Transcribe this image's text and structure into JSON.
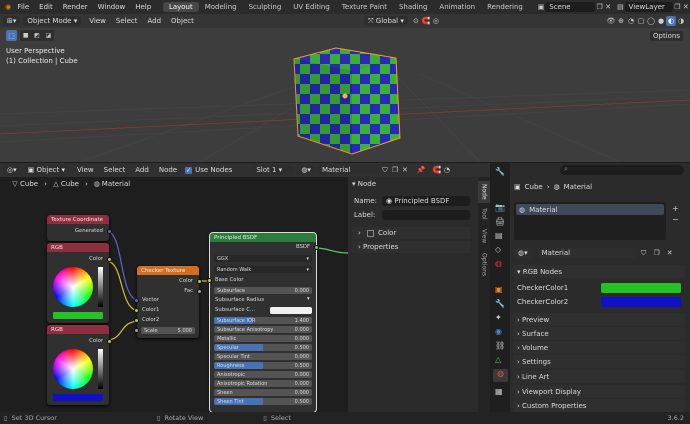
{
  "topbar": {
    "menus": [
      "File",
      "Edit",
      "Render",
      "Window",
      "Help"
    ],
    "workspaces": [
      "Layout",
      "Modeling",
      "Sculpting",
      "UV Editing",
      "Texture Paint",
      "Shading",
      "Animation",
      "Rendering"
    ],
    "active_workspace": "Layout",
    "scene": "Scene",
    "view_layer": "ViewLayer"
  },
  "viewport": {
    "mode": "Object Mode",
    "menus": [
      "View",
      "Select",
      "Add",
      "Object"
    ],
    "transform": "Global",
    "perspective": "User Perspective",
    "collection": "(1) Collection | Cube",
    "options": "Options"
  },
  "node_editor": {
    "editor_type": "Object",
    "menus": [
      "View",
      "Select",
      "Add",
      "Node"
    ],
    "use_nodes": "Use Nodes",
    "slot": "Slot 1",
    "material": "Material",
    "breadcrumb": [
      "Cube",
      "Cube",
      "Material"
    ],
    "nodes": {
      "tex_coord": {
        "title": "Texture Coordinate",
        "output": "Generated"
      },
      "rgb1": {
        "title": "RGB",
        "output": "Color",
        "color": "#22c322"
      },
      "rgb2": {
        "title": "RGB",
        "output": "Color",
        "color": "#1010c8"
      },
      "checker": {
        "title": "Checker Texture",
        "outputs": [
          "Color",
          "Fac"
        ],
        "inputs": [
          "Vector",
          "Color1",
          "Color2"
        ],
        "scale_label": "Scale",
        "scale_value": "5.000"
      },
      "bsdf": {
        "title": "Principled BSDF",
        "output": "BSDF",
        "distribution": "GGX",
        "subsurface_method": "Random Walk",
        "base_color": "Base Color",
        "rows": [
          {
            "label": "Subsurface",
            "value": "0.000"
          },
          {
            "label": "Subsurface Radius",
            "value": ""
          },
          {
            "label": "Subsurface C...",
            "value": ""
          },
          {
            "label": "Subsurface IOR",
            "value": "1.400"
          },
          {
            "label": "Subsurface Anisotropy",
            "value": "0.000"
          },
          {
            "label": "Metallic",
            "value": "0.000"
          },
          {
            "label": "Specular",
            "value": "0.500"
          },
          {
            "label": "Specular Tint",
            "value": "0.000"
          },
          {
            "label": "Roughness",
            "value": "0.500"
          },
          {
            "label": "Anisotropic",
            "value": "0.000"
          },
          {
            "label": "Anisotropic Rotation",
            "value": "0.000"
          },
          {
            "label": "Sheen",
            "value": "0.000"
          },
          {
            "label": "Sheen Tint",
            "value": "0.500"
          }
        ]
      }
    }
  },
  "npanel": {
    "section": "Node",
    "name_label": "Name:",
    "name_value": "Principled BSDF",
    "label_label": "Label:",
    "label_value": "",
    "color": "Color",
    "properties": "Properties",
    "tabs": [
      "Node",
      "Tool",
      "View",
      "Options"
    ]
  },
  "properties": {
    "breadcrumb": [
      "Cube",
      "Material"
    ],
    "slot_material": "Material",
    "material_name": "Material",
    "rgb_nodes_title": "RGB Nodes",
    "checker1_label": "CheckerColor1",
    "checker1_color": "#22c322",
    "checker2_label": "CheckerColor2",
    "checker2_color": "#1010c8",
    "sections": [
      "Preview",
      "Surface",
      "Volume",
      "Settings",
      "Line Art",
      "Viewport Display",
      "Custom Properties"
    ]
  },
  "statusbar": {
    "left": "Set 3D Cursor",
    "middle": "Rotate View",
    "right": "Select",
    "version": "3.6.2"
  }
}
